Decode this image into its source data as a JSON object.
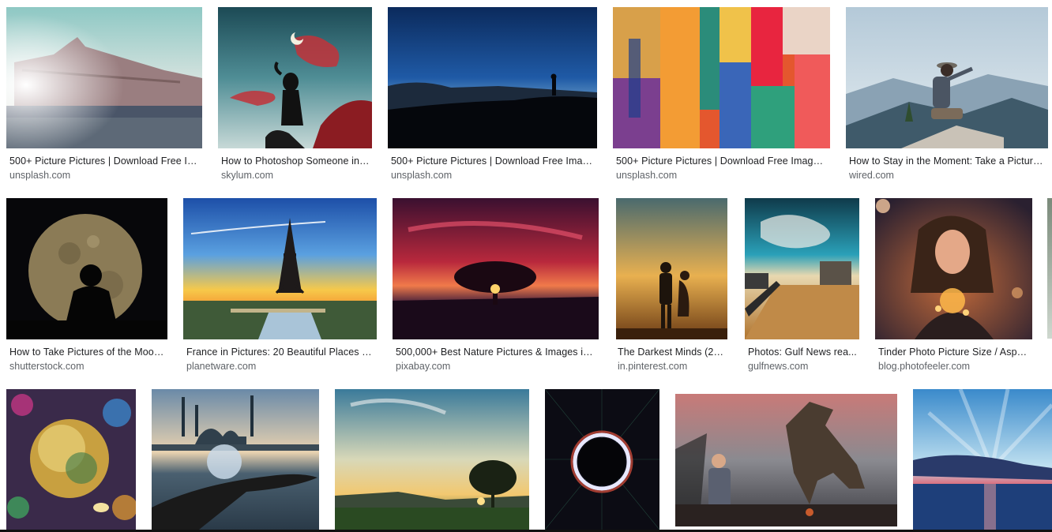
{
  "results": [
    {
      "title": "500+ Picture Pictures | Download Free Im...",
      "source": "unsplash.com",
      "image": "paris-museum-sunset"
    },
    {
      "title": "How to Photoshop Someone int...",
      "source": "skylum.com",
      "image": "girl-silhouette-red-clouds"
    },
    {
      "title": "500+ Picture Pictures | Download Free Image...",
      "source": "unsplash.com",
      "image": "blue-dusk-silhouette"
    },
    {
      "title": "500+ Picture Pictures | Download Free Images ...",
      "source": "unsplash.com",
      "image": "abstract-paint-strokes"
    },
    {
      "title": "How to Stay in the Moment: Take a Picture |...",
      "source": "wired.com",
      "image": "hiker-on-mountain"
    },
    {
      "title": "How to Take Pictures of the Moon...",
      "source": "shutterstock.com",
      "image": "moon-silhouette"
    },
    {
      "title": "France in Pictures: 20 Beautiful Places to...",
      "source": "planetware.com",
      "image": "eiffel-tower-sunset"
    },
    {
      "title": "500,000+ Best Nature Pictures & Images in ...",
      "source": "pixabay.com",
      "image": "tree-red-sky"
    },
    {
      "title": "The Darkest Minds (20...",
      "source": "in.pinterest.com",
      "image": "couple-golden-sky"
    },
    {
      "title": "Photos: Gulf News rea...",
      "source": "gulfnews.com",
      "image": "sandy-promenade"
    },
    {
      "title": "Tinder Photo Picture Size / Aspe...",
      "source": "blog.photofeeler.com",
      "image": "girl-with-lights"
    },
    {
      "title": "",
      "source": "",
      "image": "glass-globe-bokeh"
    },
    {
      "title": "",
      "source": "",
      "image": "mosque-crystal-ball"
    },
    {
      "title": "",
      "source": "",
      "image": "tree-lake-sunset"
    },
    {
      "title": "",
      "source": "",
      "image": "black-hole-ring"
    },
    {
      "title": "",
      "source": "",
      "image": "dinosaur-scene"
    },
    {
      "title": "",
      "source": "",
      "image": "sea-sunrays"
    }
  ]
}
